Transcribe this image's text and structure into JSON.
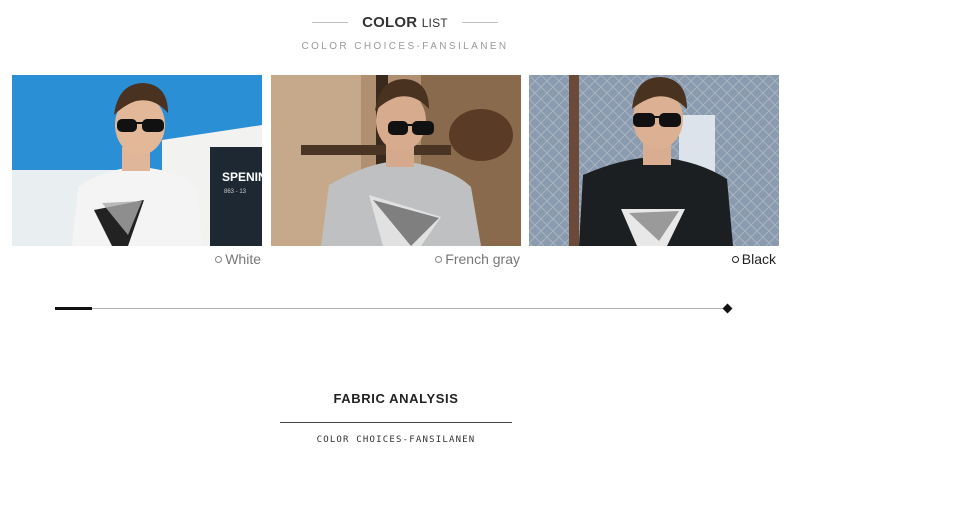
{
  "color_list": {
    "title_bold": "COLOR",
    "title_light": "LIST",
    "subtitle": "COLOR CHOICES-FANSILANEN"
  },
  "colors": [
    {
      "label": "White",
      "shirt_color": "#f4f4f4",
      "bg_color": "#2b8fd6"
    },
    {
      "label": "French gray",
      "shirt_color": "#bfc0c2",
      "bg_color": "#b09070"
    },
    {
      "label": "Black",
      "shirt_color": "#1c1f22",
      "bg_color": "#8a9bb0"
    }
  ],
  "photo_sign": {
    "line1": "SPENIN",
    "line2": "863 - 13"
  },
  "slider": {
    "position": 0.05
  },
  "fabric": {
    "title": "FABRIC ANALYSIS",
    "subtitle": "COLOR  CHOICES-FANSILANEN"
  }
}
